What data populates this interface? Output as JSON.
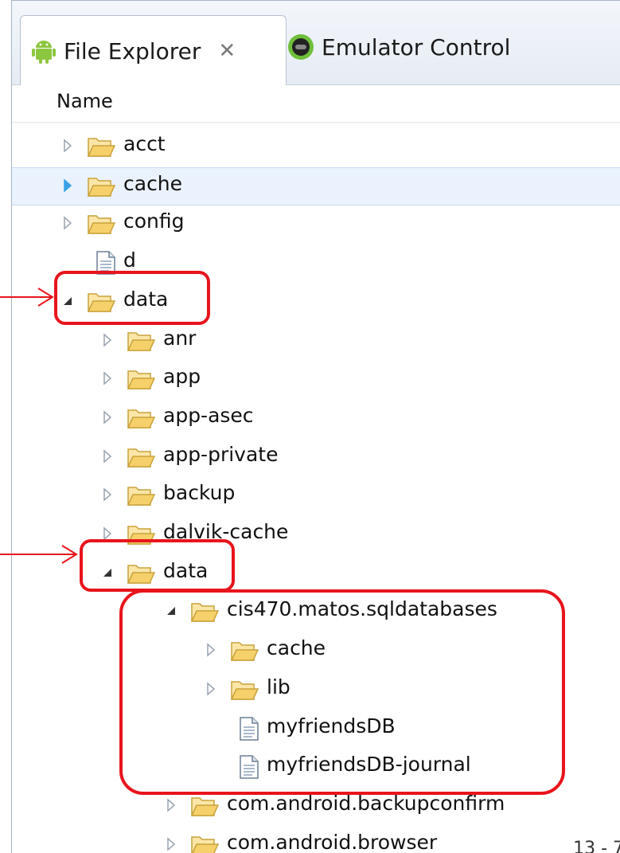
{
  "tabs": [
    {
      "label": "File Explorer",
      "close": "✕",
      "icon": "android-icon",
      "active": true
    },
    {
      "label": "Emulator Control",
      "icon": "emulator-icon",
      "active": false
    }
  ],
  "header": {
    "name_column": "Name"
  },
  "tree": [
    {
      "label": "acct",
      "type": "folder",
      "expander": "collapsed",
      "indent": 0
    },
    {
      "label": "cache",
      "type": "folder",
      "expander": "collapsed",
      "indent": 0,
      "selected": true
    },
    {
      "label": "config",
      "type": "folder",
      "expander": "collapsed",
      "indent": 0
    },
    {
      "label": "d",
      "type": "file",
      "expander": "none",
      "indent": 0
    },
    {
      "label": "data",
      "type": "folder",
      "expander": "expanded",
      "indent": 0
    },
    {
      "label": "anr",
      "type": "folder",
      "expander": "collapsed",
      "indent": 1
    },
    {
      "label": "app",
      "type": "folder",
      "expander": "collapsed",
      "indent": 1
    },
    {
      "label": "app-asec",
      "type": "folder",
      "expander": "collapsed",
      "indent": 1
    },
    {
      "label": "app-private",
      "type": "folder",
      "expander": "collapsed",
      "indent": 1
    },
    {
      "label": "backup",
      "type": "folder",
      "expander": "collapsed",
      "indent": 1
    },
    {
      "label": "dalvik-cache",
      "type": "folder",
      "expander": "collapsed",
      "indent": 1
    },
    {
      "label": "data",
      "type": "folder",
      "expander": "expanded",
      "indent": 1
    },
    {
      "label": "cis470.matos.sqldatabases",
      "type": "folder",
      "expander": "expanded",
      "indent": 2
    },
    {
      "label": "cache",
      "type": "folder",
      "expander": "collapsed",
      "indent": 3
    },
    {
      "label": "lib",
      "type": "folder",
      "expander": "collapsed",
      "indent": 3
    },
    {
      "label": "myfriendsDB",
      "type": "file",
      "expander": "none",
      "indent": 3
    },
    {
      "label": "myfriendsDB-journal",
      "type": "file",
      "expander": "none",
      "indent": 3
    },
    {
      "label": "com.android.backupconfirm",
      "type": "folder",
      "expander": "collapsed",
      "indent": 2
    },
    {
      "label": "com.android.browser",
      "type": "folder",
      "expander": "collapsed",
      "indent": 2
    }
  ],
  "page_number": "13 - 7",
  "colors": {
    "highlight": "#e8141c",
    "selection": "#eaf2fd",
    "folder": "#f2c94c",
    "expander_selected": "#3aa0e6"
  }
}
